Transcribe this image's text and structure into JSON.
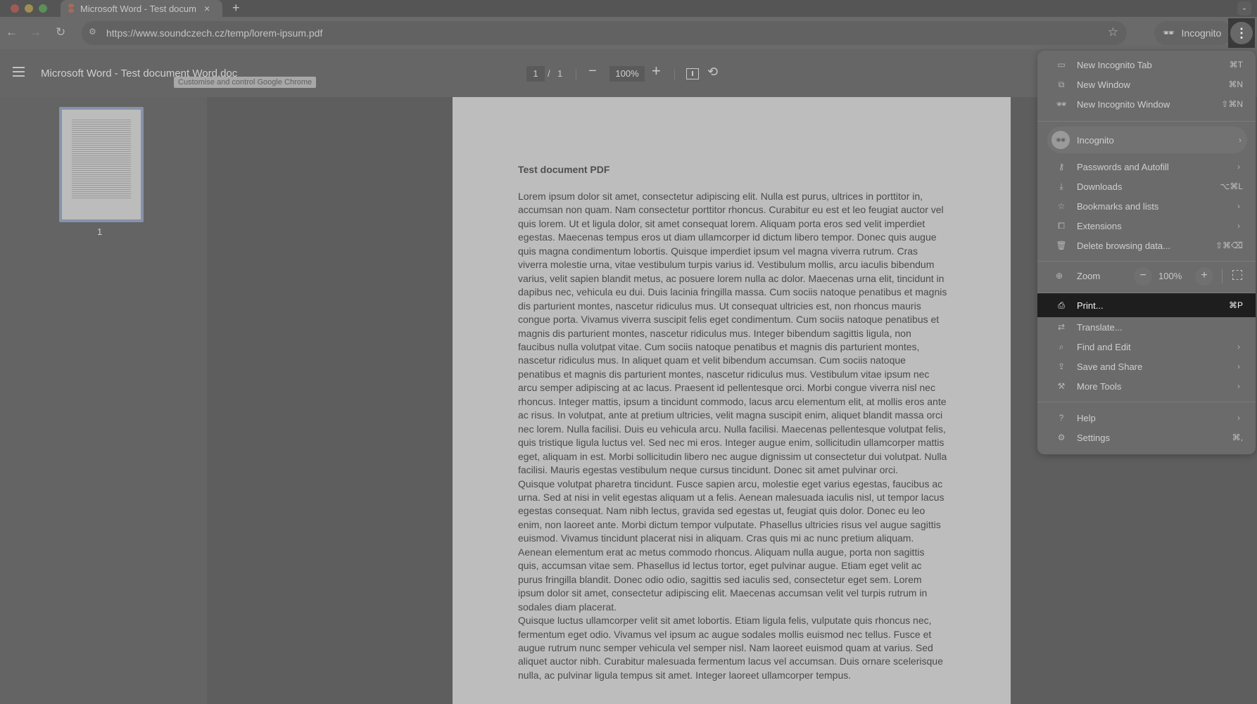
{
  "browser": {
    "tab": {
      "title": "Microsoft Word - Test docum",
      "close": "×"
    },
    "new_tab": "+",
    "tab_search": "⌄",
    "nav": {
      "back": "←",
      "forward": "→",
      "reload": "↻"
    },
    "url": "https://www.soundczech.cz/temp/lorem-ipsum.pdf",
    "site_info_icon": "⚙",
    "bookmark_icon": "☆",
    "incognito_label": "Incognito",
    "incognito_icon": "🕶",
    "menu_icon": "⋮",
    "tooltip": "Customise and control Google Chrome"
  },
  "pdf_viewer": {
    "title": "Microsoft Word - Test document Word.doc",
    "page_current": "1",
    "page_separator": "/",
    "page_total": "1",
    "zoom_minus": "−",
    "zoom_value": "100%",
    "zoom_plus": "+",
    "rotate_icon": "⟲",
    "thumbnail_label": "1"
  },
  "document": {
    "heading": "Test document PDF",
    "paragraphs": [
      "Lorem ipsum dolor sit amet, consectetur adipiscing elit. Nulla est purus, ultrices in porttitor in, accumsan non quam. Nam consectetur porttitor rhoncus. Curabitur eu est et leo feugiat auctor vel quis lorem. Ut et ligula dolor, sit amet consequat lorem. Aliquam porta eros sed velit imperdiet egestas. Maecenas tempus eros ut diam ullamcorper id dictum libero tempor. Donec quis augue quis magna condimentum lobortis. Quisque imperdiet ipsum vel magna viverra rutrum. Cras viverra molestie urna, vitae vestibulum turpis varius id. Vestibulum mollis, arcu iaculis bibendum varius, velit sapien blandit metus, ac posuere lorem nulla ac dolor. Maecenas urna elit, tincidunt in dapibus nec, vehicula eu dui. Duis lacinia fringilla massa. Cum sociis natoque penatibus et magnis dis parturient montes, nascetur ridiculus mus. Ut consequat ultricies est, non rhoncus mauris congue porta. Vivamus viverra suscipit felis eget condimentum. Cum sociis natoque penatibus et magnis dis parturient montes, nascetur ridiculus mus. Integer bibendum sagittis ligula, non faucibus nulla volutpat vitae. Cum sociis natoque penatibus et magnis dis parturient montes, nascetur ridiculus mus. In aliquet quam et velit bibendum accumsan. Cum sociis natoque penatibus et magnis dis parturient montes, nascetur ridiculus mus. Vestibulum vitae ipsum nec arcu semper adipiscing at ac lacus. Praesent id pellentesque orci. Morbi congue viverra nisl nec rhoncus. Integer mattis, ipsum a tincidunt commodo, lacus arcu elementum elit, at mollis eros ante ac risus. In volutpat, ante at pretium ultricies, velit magna suscipit enim, aliquet blandit massa orci nec lorem. Nulla facilisi. Duis eu vehicula arcu. Nulla facilisi. Maecenas pellentesque volutpat felis, quis tristique ligula luctus vel. Sed nec mi eros. Integer augue enim, sollicitudin ullamcorper mattis eget, aliquam in est. Morbi sollicitudin libero nec augue dignissim ut consectetur dui volutpat. Nulla facilisi. Mauris egestas vestibulum neque cursus tincidunt. Donec sit amet pulvinar orci.",
      "Quisque volutpat pharetra tincidunt. Fusce sapien arcu, molestie eget varius egestas, faucibus ac urna. Sed at nisi in velit egestas aliquam ut a felis. Aenean malesuada iaculis nisl, ut tempor lacus egestas consequat. Nam nibh lectus, gravida sed egestas ut, feugiat quis dolor. Donec eu leo enim, non laoreet ante. Morbi dictum tempor vulputate. Phasellus ultricies risus vel augue sagittis euismod. Vivamus tincidunt placerat nisi in aliquam. Cras quis mi ac nunc pretium aliquam. Aenean elementum erat ac metus commodo rhoncus. Aliquam nulla augue, porta non sagittis quis, accumsan vitae sem. Phasellus id lectus tortor, eget pulvinar augue. Etiam eget velit ac purus fringilla blandit. Donec odio odio, sagittis sed iaculis sed, consectetur eget sem. Lorem ipsum dolor sit amet, consectetur adipiscing elit. Maecenas accumsan velit vel turpis rutrum in sodales diam placerat.",
      "Quisque luctus ullamcorper velit sit amet lobortis. Etiam ligula felis, vulputate quis rhoncus nec, fermentum eget odio. Vivamus vel ipsum ac augue sodales mollis euismod nec tellus. Fusce et augue rutrum nunc semper vehicula vel semper nisl. Nam laoreet euismod quam at varius. Sed aliquet auctor nibh. Curabitur malesuada fermentum lacus vel accumsan. Duis ornare scelerisque nulla, ac pulvinar ligula tempus sit amet. Integer laoreet ullamcorper tempus."
    ]
  },
  "menu": {
    "items_top": [
      {
        "icon": "▭",
        "label": "New Incognito Tab",
        "shortcut": "⌘T"
      },
      {
        "icon": "⧉",
        "label": "New Window",
        "shortcut": "⌘N"
      },
      {
        "icon": "🕶",
        "label": "New Incognito Window",
        "shortcut": "⇧⌘N"
      }
    ],
    "profile": {
      "icon": "🕶",
      "label": "Incognito",
      "arrow": "›"
    },
    "items_mid": [
      {
        "icon": "⚷",
        "label": "Passwords and Autofill",
        "arrow": "›"
      },
      {
        "icon": "⤓",
        "label": "Downloads",
        "shortcut": "⌥⌘L"
      },
      {
        "icon": "☆",
        "label": "Bookmarks and lists",
        "arrow": "›"
      },
      {
        "icon": "⧠",
        "label": "Extensions",
        "arrow": "›"
      },
      {
        "icon": "🗑",
        "label": "Delete browsing data...",
        "shortcut": "⇧⌘⌫"
      }
    ],
    "zoom": {
      "icon": "⊕",
      "label": "Zoom",
      "minus": "−",
      "value": "100%",
      "plus": "+"
    },
    "items_tools": [
      {
        "icon": "⎙",
        "label": "Print...",
        "shortcut": "⌘P",
        "active": true
      },
      {
        "icon": "⇄",
        "label": "Translate..."
      },
      {
        "icon": "⌕",
        "label": "Find and Edit",
        "arrow": "›"
      },
      {
        "icon": "⇪",
        "label": "Save and Share",
        "arrow": "›"
      },
      {
        "icon": "⚒",
        "label": "More Tools",
        "arrow": "›"
      }
    ],
    "items_bottom": [
      {
        "icon": "?",
        "label": "Help",
        "arrow": "›"
      },
      {
        "icon": "⚙",
        "label": "Settings",
        "shortcut": "⌘,"
      }
    ]
  }
}
